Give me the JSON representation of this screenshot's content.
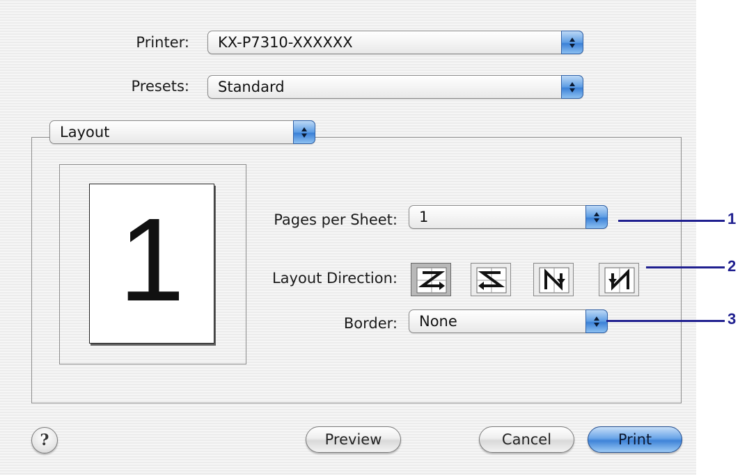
{
  "printer": {
    "label": "Printer:",
    "value": "KX-P7310-XXXXXX"
  },
  "presets": {
    "label": "Presets:",
    "value": "Standard"
  },
  "panel": {
    "value": "Layout"
  },
  "preview": {
    "page_number": "1"
  },
  "pages_per_sheet": {
    "label": "Pages per Sheet:",
    "value": "1"
  },
  "layout_direction": {
    "label": "Layout Direction:",
    "options": [
      "z-left-to-right",
      "z-right-to-left",
      "n-top-to-bottom-left",
      "n-top-to-bottom-right"
    ],
    "selected_index": 0
  },
  "border": {
    "label": "Border:",
    "value": "None"
  },
  "buttons": {
    "help": "?",
    "preview": "Preview",
    "cancel": "Cancel",
    "print": "Print"
  },
  "callouts": [
    "1",
    "2",
    "3"
  ],
  "colors": {
    "accent": "#3f83d8",
    "callout": "#1f1f8f"
  }
}
